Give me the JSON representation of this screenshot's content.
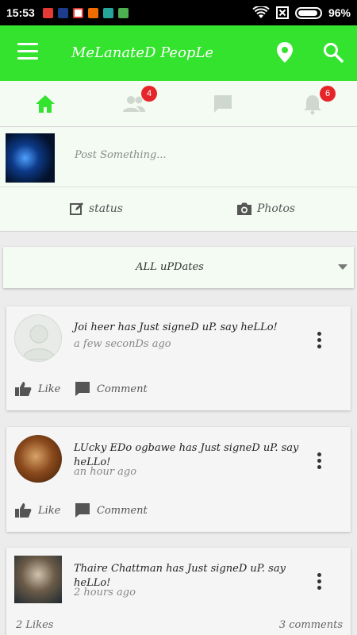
{
  "status_bar": {
    "time": "15:53",
    "battery": "96%",
    "notification_app_colors": [
      "#e53935",
      "#1e3c8c",
      "#e53935",
      "#ef6c00",
      "#26a69a",
      "#4caf50"
    ]
  },
  "app_bar": {
    "title": "MeLanateD PeopLe",
    "color": "#33e32d"
  },
  "tabs": {
    "friends_badge": "4",
    "notifications_badge": "6",
    "active_color": "#33e32d",
    "inactive_color": "#cfd8cf"
  },
  "composer": {
    "placeholder": "Post Something...",
    "status_label": "status",
    "photos_label": "Photos"
  },
  "filter": {
    "selected": "ALL uPDates"
  },
  "feed": [
    {
      "user": "Joi heer",
      "message": " has Just signeD uP. say heLLo!",
      "time": "a few seconDs ago",
      "like_label": "Like",
      "comment_label": "Comment"
    },
    {
      "user": "LUcky EDo ogbawe",
      "message": " has Just signeD uP. say heLLo!",
      "time": "an hour ago",
      "like_label": "Like",
      "comment_label": "Comment"
    },
    {
      "user": "Thaire Chattman",
      "message": " has Just signeD uP. say heLLo!",
      "time": "2 hours ago",
      "likes_count": "2 Likes",
      "comments_count": "3 comments"
    }
  ]
}
